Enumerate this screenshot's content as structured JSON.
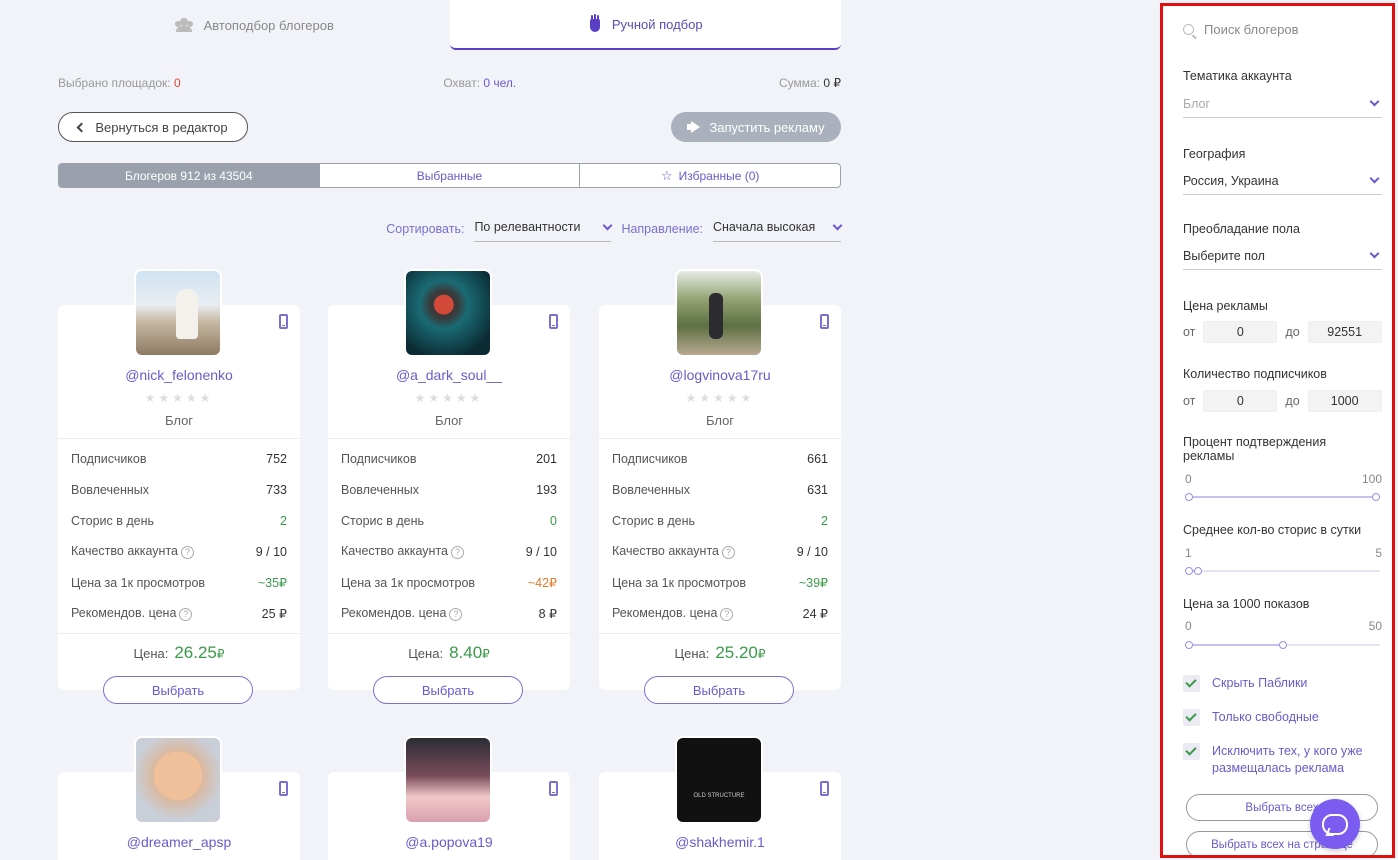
{
  "tabs": [
    {
      "label": "Автоподбор блогеров",
      "icon": "people-icon"
    },
    {
      "label": "Ручной подбор",
      "icon": "hand-icon"
    }
  ],
  "summary": {
    "platforms_label": "Выбрано площадок:",
    "platforms_value": "0",
    "reach_label": "Охват:",
    "reach_value": "0 чел.",
    "sum_label": "Сумма:",
    "sum_value": "0 ₽"
  },
  "buttons": {
    "back": "Вернуться в редактор",
    "launch": "Запустить рекламу"
  },
  "segments": [
    "Блогеров 912 из 43504",
    "Выбранные",
    "Избранные (0)"
  ],
  "sort": {
    "sort_label": "Сортировать:",
    "sort_value": "По релевантности",
    "direction_label": "Направление:",
    "direction_value": "Сначала высокая"
  },
  "card_labels": {
    "subscribers": "Подписчиков",
    "engaged": "Вовлеченных",
    "stories": "Сторис в день",
    "quality": "Качество аккаунта",
    "cpm": "Цена за 1к просмотров",
    "recommended": "Рекомендов. цена",
    "price": "Цена:",
    "select": "Выбрать",
    "currency": "₽",
    "quality_max": "10",
    "stars": "★★★★★"
  },
  "cards": [
    {
      "handle": "@nick_felonenko",
      "category": "Блог",
      "subscribers": "752",
      "engaged": "733",
      "stories": "2",
      "quality": "9",
      "cpm": "~35₽",
      "recommended": "25 ₽",
      "price": "26.25"
    },
    {
      "handle": "@a_dark_soul__",
      "category": "Блог",
      "subscribers": "201",
      "engaged": "193",
      "stories": "0",
      "quality": "9",
      "cpm": "~42₽",
      "recommended": "8 ₽",
      "price": "8.40"
    },
    {
      "handle": "@logvinova17ru",
      "category": "Блог",
      "subscribers": "661",
      "engaged": "631",
      "stories": "2",
      "quality": "9",
      "cpm": "~39₽",
      "recommended": "24 ₽",
      "price": "25.20"
    },
    {
      "handle": "@dreamer_apsp"
    },
    {
      "handle": "@a.popova19"
    },
    {
      "handle": "@shakhemir.1"
    }
  ],
  "sidebar": {
    "search_placeholder": "Поиск блогеров",
    "topic_label": "Тематика аккаунта",
    "topic_value": "Блог",
    "geo_label": "География",
    "geo_value": "Россия, Украина",
    "gender_label": "Преобладание пола",
    "gender_value": "Выберите пол",
    "ad_price_label": "Цена рекламы",
    "from": "от",
    "to": "до",
    "ad_price_from": "0",
    "ad_price_to": "92551",
    "subs_label": "Количество подписчиков",
    "subs_from": "0",
    "subs_to": "1000",
    "confirm_label": "Процент подтверждения рекламы",
    "confirm_min": "0",
    "confirm_max": "100",
    "stories_label": "Среднее кол-во сторис в сутки",
    "stories_min": "1",
    "stories_max": "5",
    "cpm_label": "Цена за 1000 показов",
    "cpm_min": "0",
    "cpm_max": "50",
    "check_hide_publics": "Скрыть Паблики",
    "check_only_free": "Только свободные",
    "check_exclude": "Исключить тех, у кого уже размещалась реклама",
    "select_all": "Выбрать всех",
    "select_all_page": "Выбрать всех на странице"
  },
  "slider_levels": {
    "confirm": {
      "low": 0,
      "high": 100
    },
    "stories": {
      "low": 1,
      "high": 1.2
    },
    "cpm": {
      "low": 0,
      "high": 25
    }
  }
}
